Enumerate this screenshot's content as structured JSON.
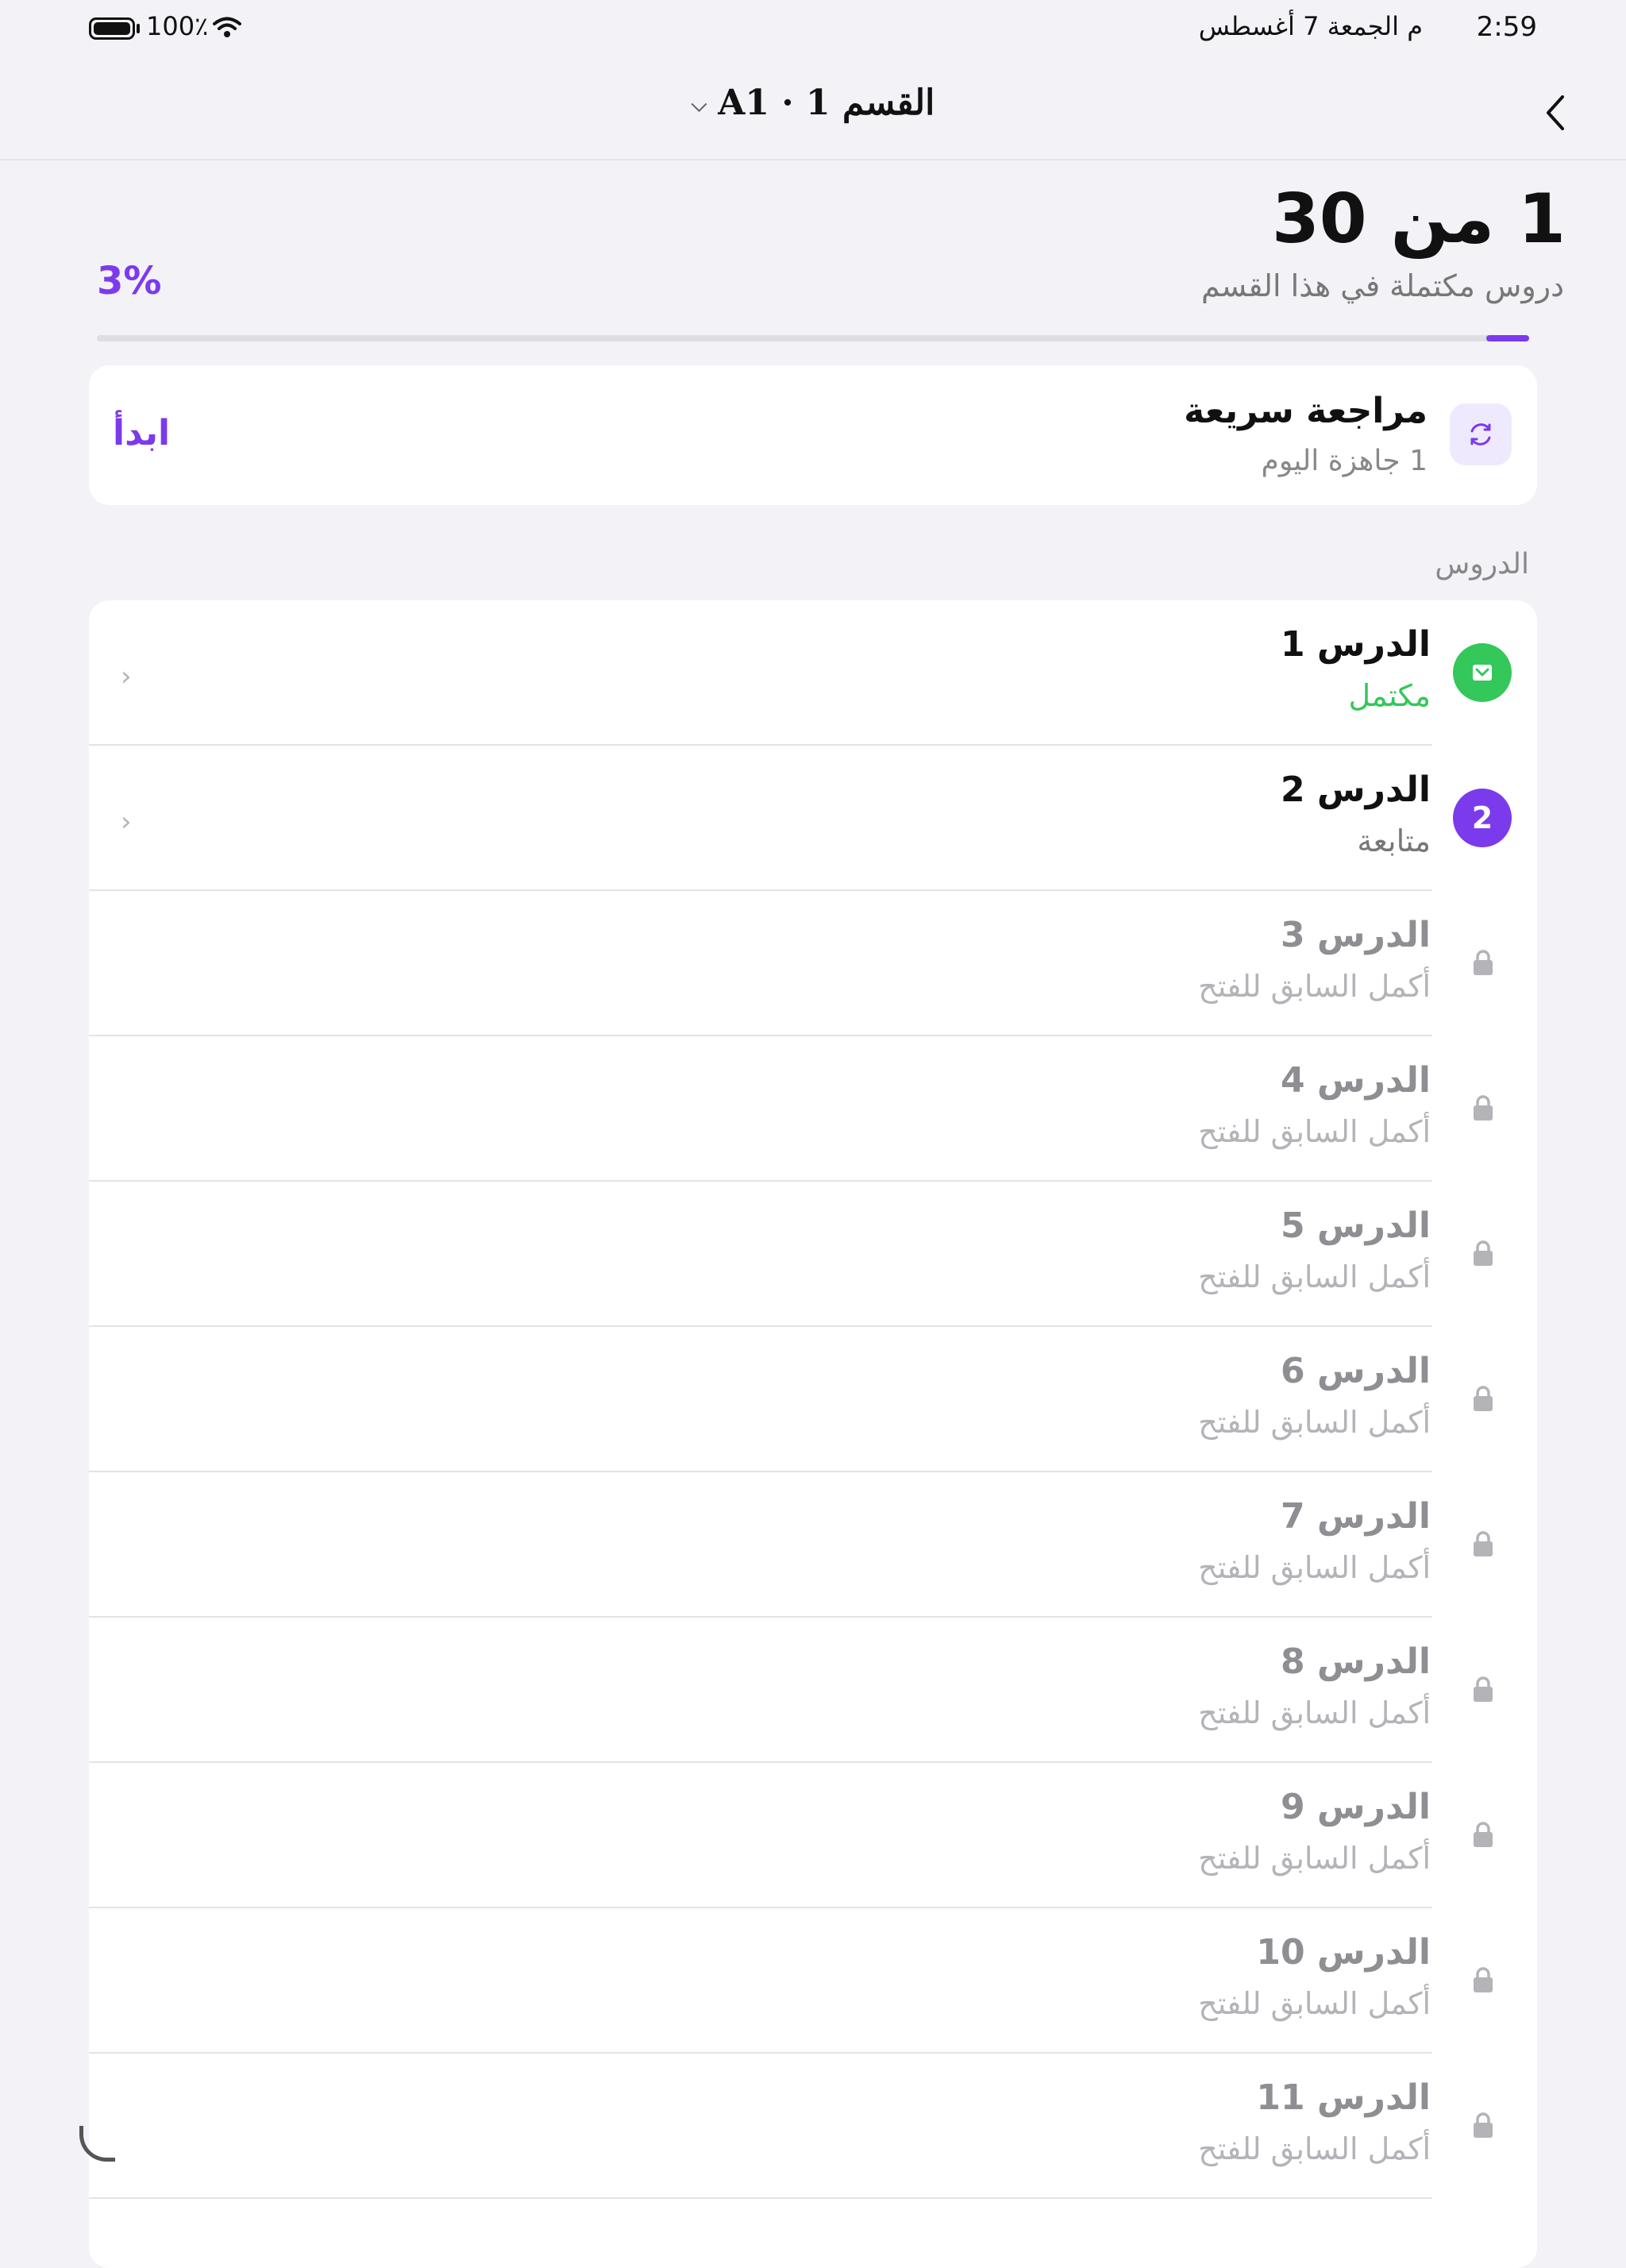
{
  "status_bar": {
    "time": "2:59",
    "date": "م  الجمعة 7 أغسطس",
    "battery": "100٪"
  },
  "nav": {
    "title": "القسم 1 · A1"
  },
  "progress": {
    "count_text": "1 من 30",
    "caption": "دروس مكتملة في هذا القسم",
    "percent_text": "3%",
    "percent_value": 3,
    "accent_color": "#7c3aed"
  },
  "review": {
    "title": "مراجعة سريعة",
    "subtitle": "1 جاهزة اليوم",
    "start_label": "ابدأ",
    "icon": "refresh-icon"
  },
  "lessons_label": "الدروس",
  "lessons": [
    {
      "title": "الدرس 1",
      "status": "مكتمل",
      "state": "complete",
      "badge": ""
    },
    {
      "title": "الدرس 2",
      "status": "متابعة",
      "state": "current",
      "badge": "2"
    },
    {
      "title": "الدرس 3",
      "status": "أكمل السابق للفتح",
      "state": "locked",
      "badge": ""
    },
    {
      "title": "الدرس 4",
      "status": "أكمل السابق للفتح",
      "state": "locked",
      "badge": ""
    },
    {
      "title": "الدرس 5",
      "status": "أكمل السابق للفتح",
      "state": "locked",
      "badge": ""
    },
    {
      "title": "الدرس 6",
      "status": "أكمل السابق للفتح",
      "state": "locked",
      "badge": ""
    },
    {
      "title": "الدرس 7",
      "status": "أكمل السابق للفتح",
      "state": "locked",
      "badge": ""
    },
    {
      "title": "الدرس 8",
      "status": "أكمل السابق للفتح",
      "state": "locked",
      "badge": ""
    },
    {
      "title": "الدرس 9",
      "status": "أكمل السابق للفتح",
      "state": "locked",
      "badge": ""
    },
    {
      "title": "الدرس 10",
      "status": "أكمل السابق للفتح",
      "state": "locked",
      "badge": ""
    },
    {
      "title": "الدرس 11",
      "status": "أكمل السابق للفتح",
      "state": "locked",
      "badge": ""
    }
  ],
  "colors": {
    "accent": "#7c3aed",
    "complete": "#34c759",
    "background": "#f2f2f7"
  }
}
